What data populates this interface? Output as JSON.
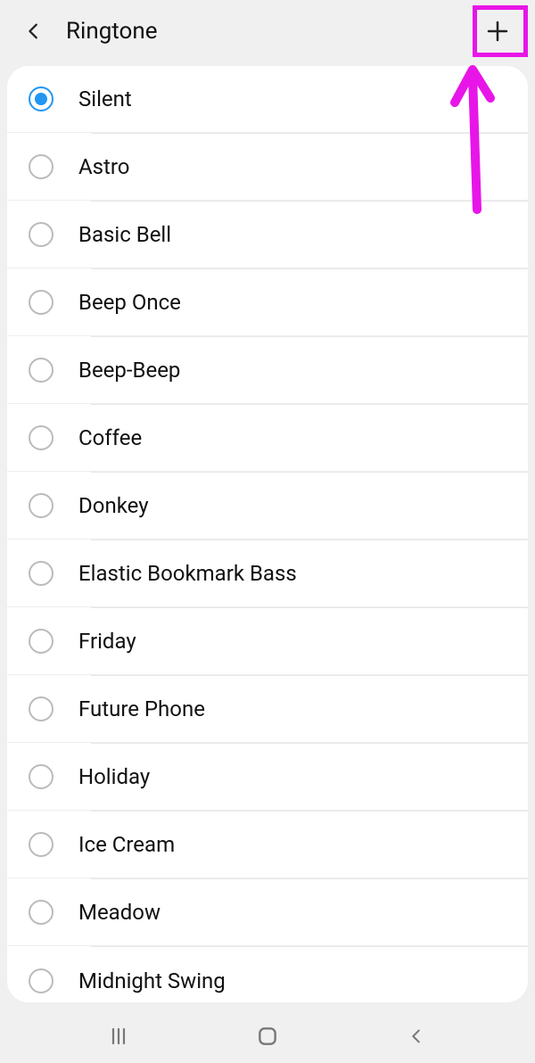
{
  "header": {
    "title": "Ringtone"
  },
  "ringtones": [
    {
      "label": "Silent",
      "selected": true
    },
    {
      "label": "Astro",
      "selected": false
    },
    {
      "label": "Basic Bell",
      "selected": false
    },
    {
      "label": "Beep Once",
      "selected": false
    },
    {
      "label": "Beep-Beep",
      "selected": false
    },
    {
      "label": "Coffee",
      "selected": false
    },
    {
      "label": "Donkey",
      "selected": false
    },
    {
      "label": "Elastic Bookmark Bass",
      "selected": false
    },
    {
      "label": "Friday",
      "selected": false
    },
    {
      "label": "Future Phone",
      "selected": false
    },
    {
      "label": "Holiday",
      "selected": false
    },
    {
      "label": "Ice Cream",
      "selected": false
    },
    {
      "label": "Meadow",
      "selected": false
    },
    {
      "label": "Midnight Swing",
      "selected": false
    }
  ],
  "annotation": {
    "highlight_color": "#e815e8"
  }
}
